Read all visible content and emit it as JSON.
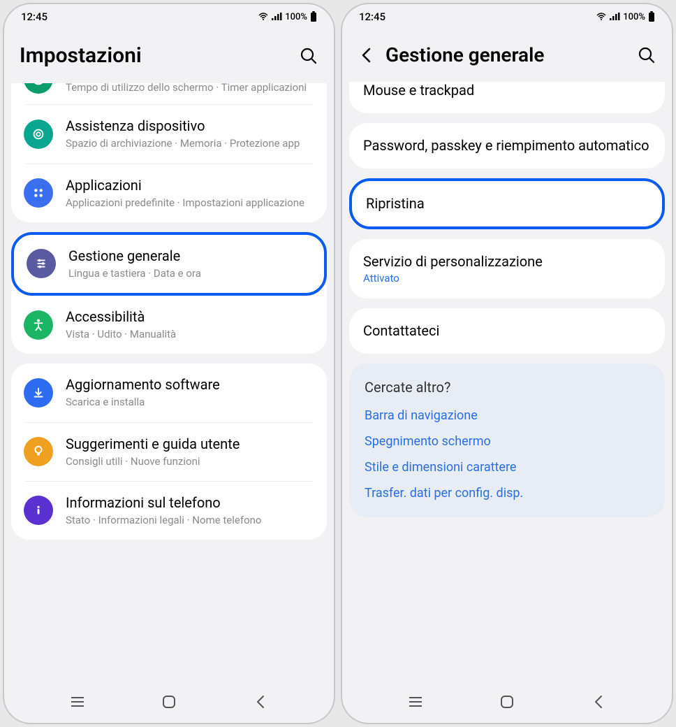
{
  "status": {
    "time": "12:45",
    "battery": "100%"
  },
  "left": {
    "title": "Impostazioni",
    "items": {
      "wellbeing_sub": "Tempo di utilizzo dello schermo  ·  Timer applicazioni",
      "device_care": {
        "title": "Assistenza dispositivo",
        "sub": "Spazio di archiviazione  ·  Memoria  ·  Protezione app"
      },
      "apps": {
        "title": "Applicazioni",
        "sub": "Applicazioni predefinite  ·  Impostazioni applicazione"
      },
      "general": {
        "title": "Gestione generale",
        "sub": "Lingua e tastiera  ·  Data e ora"
      },
      "accessibility": {
        "title": "Accessibilità",
        "sub": "Vista  ·  Udito  ·  Manualità"
      },
      "update": {
        "title": "Aggiornamento software",
        "sub": "Scarica e installa"
      },
      "tips": {
        "title": "Suggerimenti e guida utente",
        "sub": "Consigli utili  ·  Nuove funzioni"
      },
      "about": {
        "title": "Informazioni sul telefono",
        "sub": "Stato  ·  Informazioni legali  ·  Nome telefono"
      }
    }
  },
  "right": {
    "title": "Gestione generale",
    "items": {
      "mouse": "Mouse e trackpad",
      "password": "Password, passkey e riempimento automatico",
      "reset": "Ripristina",
      "personalize": {
        "title": "Servizio di personalizzazione",
        "status": "Attivato"
      },
      "contact": "Contattateci"
    },
    "suggest": {
      "heading": "Cercate altro?",
      "links": [
        "Barra di navigazione",
        "Spegnimento schermo",
        "Stile e dimensioni carattere",
        "Trasfer. dati per config. disp."
      ]
    }
  }
}
